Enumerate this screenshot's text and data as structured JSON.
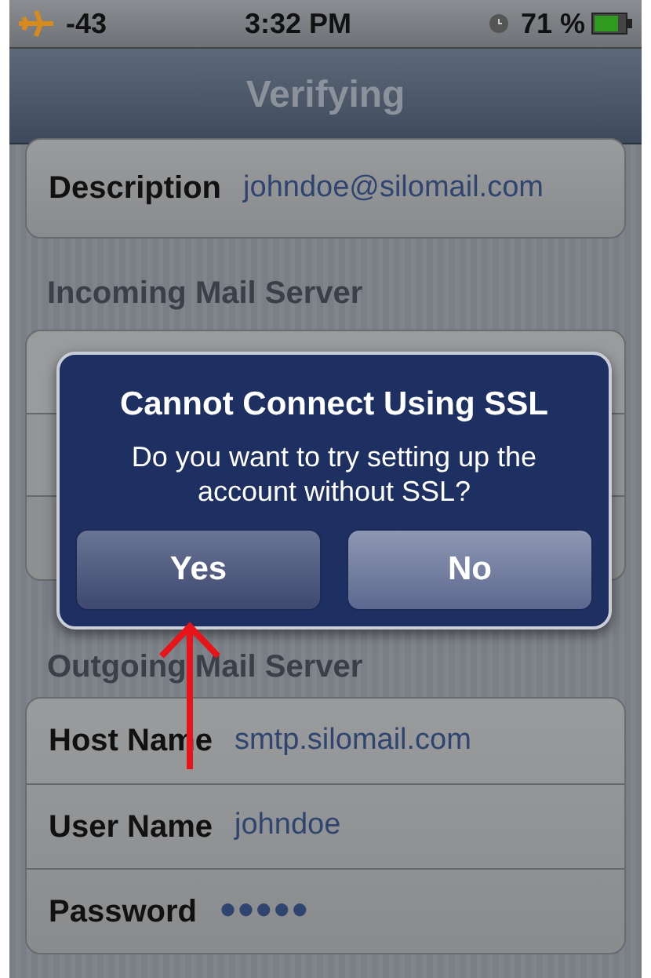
{
  "status_bar": {
    "signal": "-43",
    "time": "3:32 PM",
    "battery": "71 %"
  },
  "nav_bar": {
    "title": "Verifying"
  },
  "sections": [
    {
      "rows": [
        {
          "label": "Description",
          "value": "johndoe@silomail.com"
        }
      ]
    },
    {
      "header": "Incoming Mail Server"
    },
    {
      "header": "Outgoing Mail Server",
      "rows": [
        {
          "label": "Host Name",
          "value": "smtp.silomail.com"
        },
        {
          "label": "User Name",
          "value": "johndoe"
        },
        {
          "label": "Password",
          "value": "●●●●●"
        }
      ]
    }
  ],
  "alert": {
    "title": "Cannot Connect Using SSL",
    "message": "Do you want to try setting up the account without SSL?",
    "buttons": [
      {
        "label": "Yes",
        "kind": "cancel"
      },
      {
        "label": "No",
        "kind": "default"
      }
    ]
  }
}
